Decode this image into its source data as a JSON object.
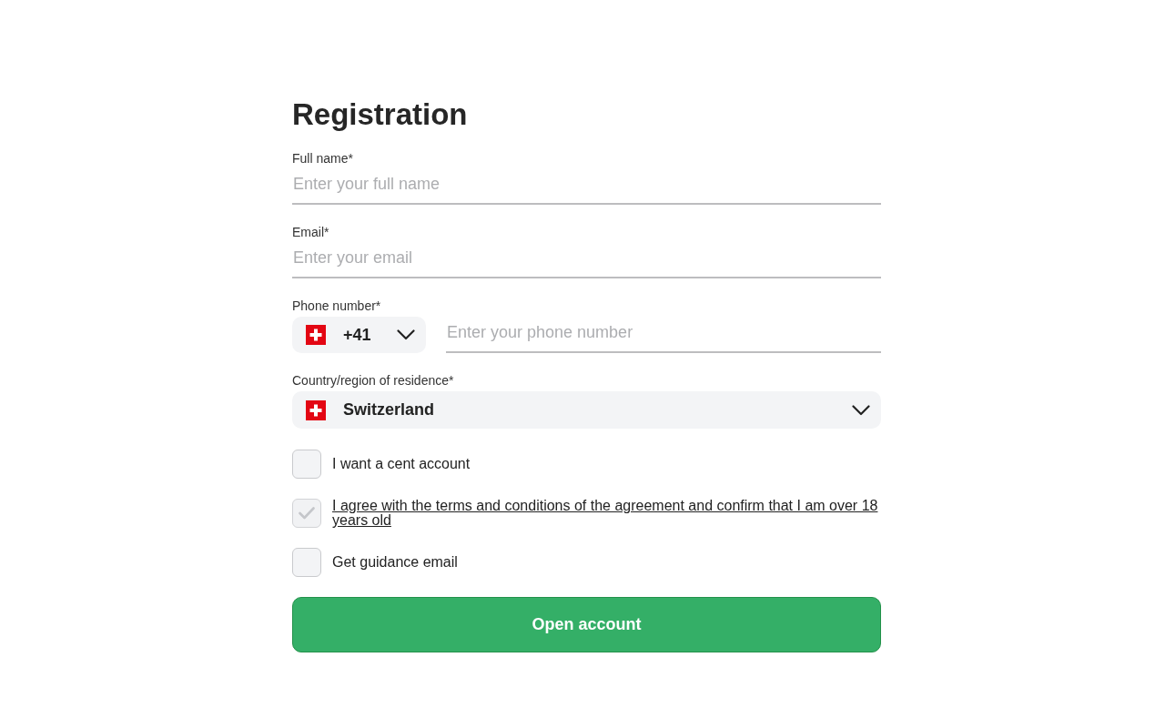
{
  "title": "Registration",
  "fields": [
    {
      "label": "Full name*",
      "placeholder": "Enter your full name"
    },
    {
      "label": "Email*",
      "placeholder": "Enter your email"
    }
  ],
  "phone": {
    "label": "Phone number*",
    "code": "+41",
    "placeholder": "Enter your phone number"
  },
  "country": {
    "label": "Country/region of residence*",
    "value": "Switzerland"
  },
  "checkboxes": [
    {
      "kind": "plain",
      "label": "I want a cent account",
      "checked": false
    },
    {
      "kind": "link",
      "label": "I agree with the terms and conditions of the agreement and confirm that I am over 18 years old",
      "checked": true
    },
    {
      "kind": "plain",
      "label": "Get guidance email",
      "checked": false
    }
  ],
  "button": "Open account"
}
